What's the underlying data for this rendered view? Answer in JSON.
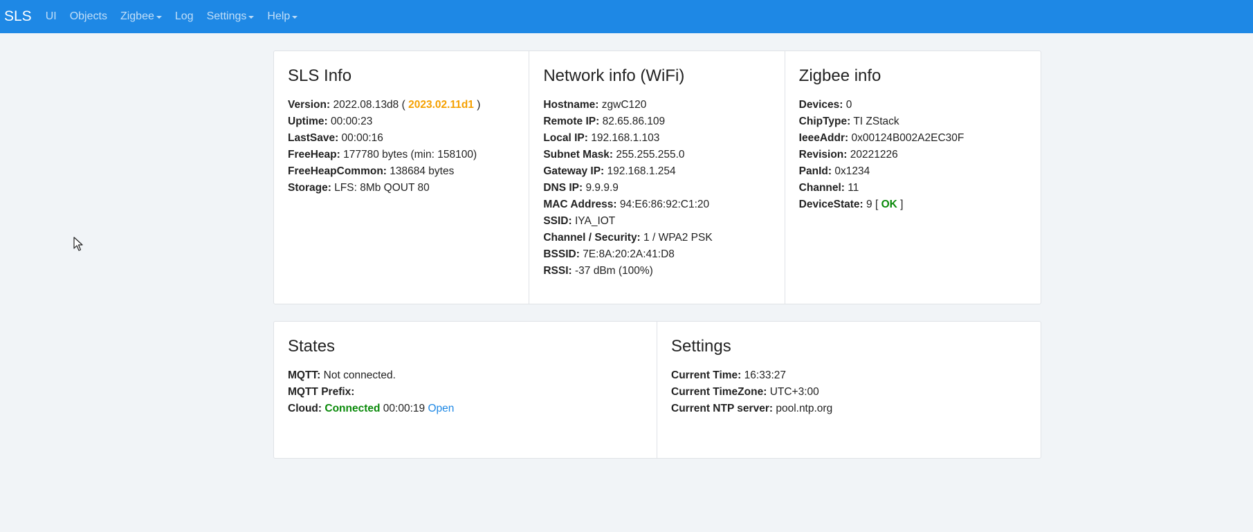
{
  "nav": {
    "brand": "SLS",
    "items": [
      {
        "label": "UI",
        "dropdown": false
      },
      {
        "label": "Objects",
        "dropdown": false
      },
      {
        "label": "Zigbee",
        "dropdown": true
      },
      {
        "label": "Log",
        "dropdown": false
      },
      {
        "label": "Settings",
        "dropdown": true
      },
      {
        "label": "Help",
        "dropdown": true
      }
    ]
  },
  "sls_info": {
    "title": "SLS Info",
    "version_label": "Version:",
    "version": "2022.08.13d8",
    "version_open": "(",
    "new_version": "2023.02.11d1",
    "version_close": ")",
    "uptime_label": "Uptime:",
    "uptime": "00:00:23",
    "lastsave_label": "LastSave:",
    "lastsave": "00:00:16",
    "freeheap_label": "FreeHeap:",
    "freeheap": "177780 bytes (min: 158100)",
    "freeheapcommon_label": "FreeHeapCommon:",
    "freeheapcommon": "138684 bytes",
    "storage_label": "Storage:",
    "storage": "LFS: 8Mb QOUT 80"
  },
  "network_info": {
    "title": "Network info (WiFi)",
    "rows": [
      {
        "label": "Hostname:",
        "value": "zgwC120"
      },
      {
        "label": "Remote IP:",
        "value": "82.65.86.109"
      },
      {
        "label": "Local IP:",
        "value": "192.168.1.103"
      },
      {
        "label": "Subnet Mask:",
        "value": "255.255.255.0"
      },
      {
        "label": "Gateway IP:",
        "value": "192.168.1.254"
      },
      {
        "label": "DNS IP:",
        "value": "9.9.9.9"
      },
      {
        "label": "MAC Address:",
        "value": "94:E6:86:92:C1:20"
      },
      {
        "label": "SSID:",
        "value": "IYA_IOT"
      },
      {
        "label": "Channel / Security:",
        "value": "1 / WPA2 PSK"
      },
      {
        "label": "BSSID:",
        "value": "7E:8A:20:2A:41:D8"
      },
      {
        "label": "RSSI:",
        "value": "-37 dBm (100%)"
      }
    ]
  },
  "zigbee_info": {
    "title": "Zigbee info",
    "rows": [
      {
        "label": "Devices:",
        "value": "0"
      },
      {
        "label": "ChipType:",
        "value": "TI ZStack"
      },
      {
        "label": "IeeeAddr:",
        "value": "0x00124B002A2EC30F"
      },
      {
        "label": "Revision:",
        "value": "20221226"
      },
      {
        "label": "PanId:",
        "value": "0x1234"
      },
      {
        "label": "Channel:",
        "value": "11"
      }
    ],
    "devicestate_label": "DeviceState:",
    "devicestate": "9",
    "devicestate_open": "[",
    "devicestate_status": "OK",
    "devicestate_close": "]"
  },
  "states": {
    "title": "States",
    "mqtt_label": "MQTT:",
    "mqtt": "Not connected.",
    "mqtt_prefix_label": "MQTT Prefix:",
    "mqtt_prefix": "",
    "cloud_label": "Cloud:",
    "cloud_status": "Connected",
    "cloud_time": "00:00:19",
    "cloud_link": "Open"
  },
  "settings": {
    "title": "Settings",
    "rows": [
      {
        "label": "Current Time:",
        "value": "16:33:27"
      },
      {
        "label": "Current TimeZone:",
        "value": "UTC+3:00"
      },
      {
        "label": "Current NTP server:",
        "value": "pool.ntp.org"
      }
    ]
  },
  "colors": {
    "navbar": "#1e88e5",
    "accent_orange": "#f5a000",
    "status_green": "#0a8a0a",
    "link": "#1e88e5"
  },
  "icons": {
    "cursor": "mouse-pointer-icon",
    "dropdown": "caret-down-icon"
  }
}
